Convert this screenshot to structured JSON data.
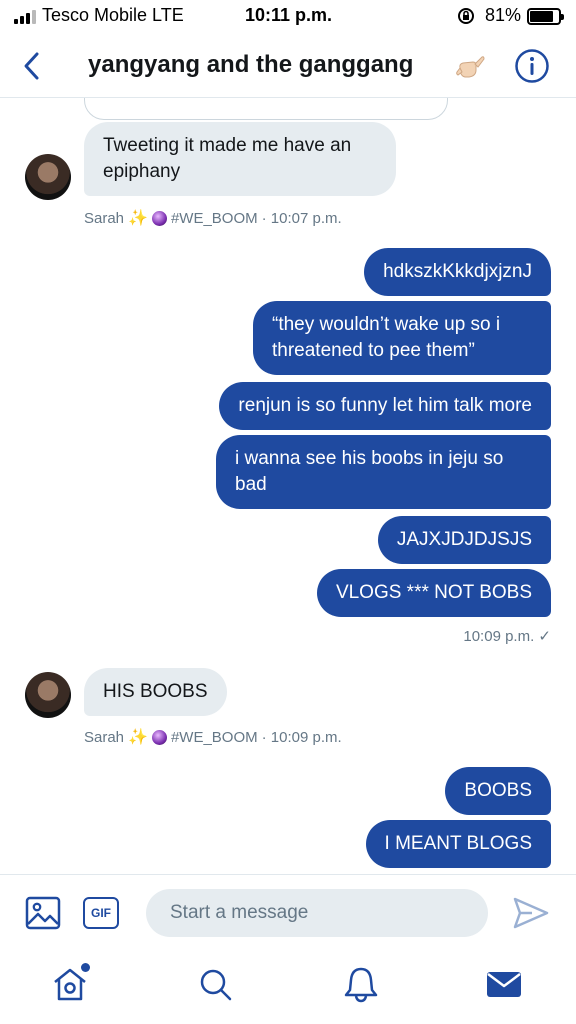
{
  "status_bar": {
    "carrier": "Tesco Mobile  LTE",
    "time": "10:11 p.m.",
    "battery": "81%",
    "battery_level": 0.81
  },
  "header": {
    "title": "yangyang and the ganggang",
    "back_icon": "chevron-left-icon",
    "info_icon": "info-icon",
    "title_emoji": "call-me-hand-emoji"
  },
  "conversation": {
    "incoming_1": {
      "text": "Tweeting it made me have an epiphany",
      "sender": "Sarah",
      "handle": "#WE_BOOM",
      "time": "· 10:07 p.m."
    },
    "outgoing_1": [
      {
        "text": "hdkszkKkkdjxjznJ"
      },
      {
        "text": "“they wouldn’t wake up so i threatened to pee them”"
      },
      {
        "text": "renjun is so funny let him talk more"
      },
      {
        "text": "i wanna see his boobs in jeju so bad"
      },
      {
        "text": "JAJXJDJDJSJS"
      },
      {
        "text": "VLOGS *** NOT BOBS"
      }
    ],
    "outgoing_1_meta": "10:09 p.m. ✓",
    "incoming_2": {
      "text": "HIS BOOBS",
      "sender": "Sarah",
      "handle": "#WE_BOOM",
      "time": "· 10:09 p.m."
    },
    "outgoing_2": [
      {
        "text": "BOOBS"
      },
      {
        "text": "I MEANT BLOGS"
      }
    ]
  },
  "composer": {
    "placeholder": "Start a message",
    "gif_label": "GIF",
    "media_icon": "image-icon",
    "send_icon": "send-icon"
  },
  "tabbar": {
    "items": [
      "home-icon",
      "search-icon",
      "notifications-bell-icon",
      "messages-mail-icon"
    ],
    "active": "messages-mail-icon",
    "accent": "#1f4aa0"
  }
}
